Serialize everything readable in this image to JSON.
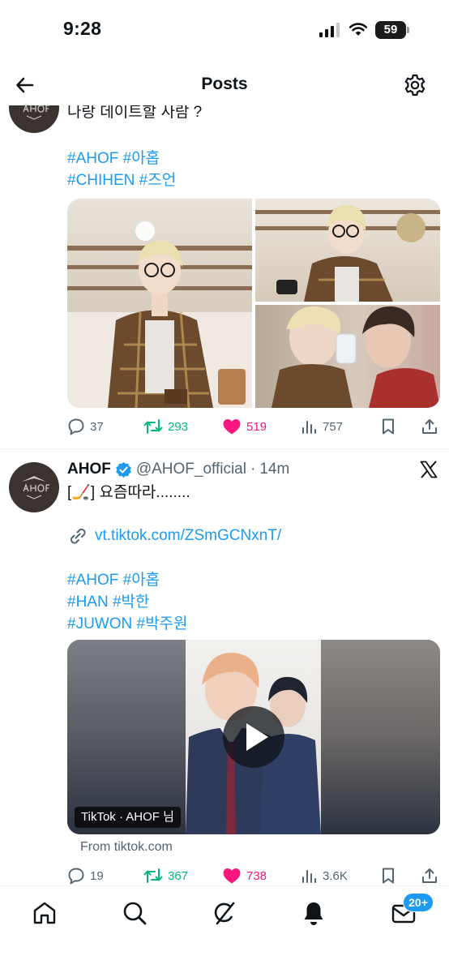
{
  "status_bar": {
    "time": "9:28",
    "battery": "59"
  },
  "nav": {
    "title": "Posts"
  },
  "post1": {
    "text": "나랑 데이트할 사람 ?",
    "hashtags_line1": "#AHOF #아홉",
    "hashtags_line2": "#CHIHEN #즈언",
    "stats": {
      "replies": "37",
      "reposts": "293",
      "likes": "519",
      "views": "757"
    }
  },
  "post2": {
    "author_name": "AHOF",
    "handle": "@AHOF_official",
    "time_ago": "14m",
    "text": "[🏒] 요즘따라........",
    "link": "vt.tiktok.com/ZSmGCNxnT/",
    "hashtags_line1": "#AHOF #아홉",
    "hashtags_line2": "#HAN #박한",
    "hashtags_line3": "#JUWON #박주원",
    "video_badge": "TikTok · AHOF 님",
    "from_label": "From tiktok.com",
    "stats": {
      "replies": "19",
      "reposts": "367",
      "likes": "738",
      "views": "3.6K"
    }
  },
  "tab_bar": {
    "messages_badge": "20+"
  },
  "colors": {
    "accent": "#1d9bf0",
    "like": "#f91880",
    "repost": "#00ba7c",
    "muted": "#536471"
  },
  "icons": [
    "back-arrow-icon",
    "gear-icon",
    "verified-badge-icon",
    "x-logo-icon",
    "link-icon",
    "reply-icon",
    "repost-icon",
    "heart-icon",
    "views-icon",
    "bookmark-icon",
    "share-icon",
    "home-icon",
    "search-icon",
    "grok-icon",
    "bell-icon",
    "mail-icon"
  ]
}
